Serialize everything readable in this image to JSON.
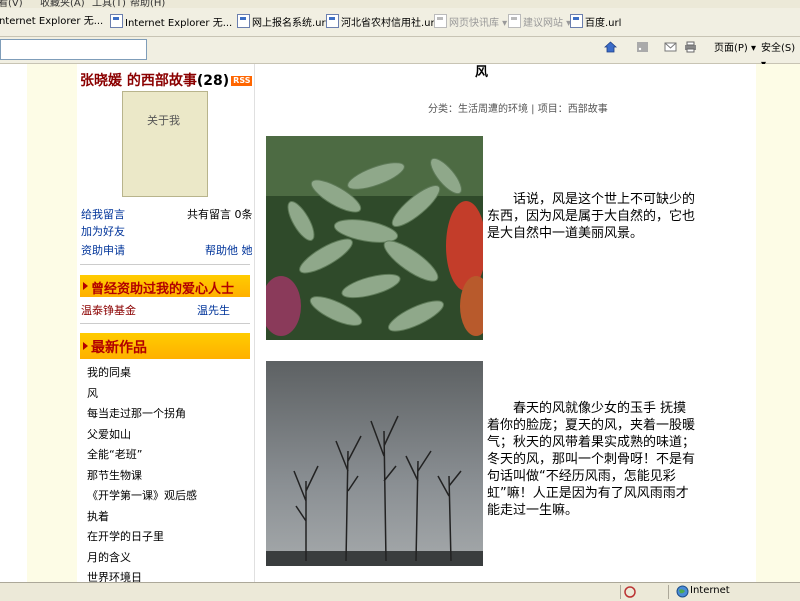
{
  "menu": {
    "items": [
      "看(V)",
      "收藏夹(A)",
      "工具(T)",
      "帮助(H)"
    ]
  },
  "favorites": [
    {
      "label": "Internet Explorer 无...",
      "gray": false
    },
    {
      "label": "Internet Explorer 无...",
      "gray": false
    },
    {
      "label": "网上报名系统.url",
      "gray": false
    },
    {
      "label": "河北省农村信用社.url",
      "gray": false
    },
    {
      "label": "网页快讯库 ▾",
      "gray": true
    },
    {
      "label": "建议网站 ▾",
      "gray": true
    },
    {
      "label": "百度.url",
      "gray": false
    }
  ],
  "toolbar": {
    "page_label": "页面(P) ▾",
    "safety_label": "安全(S) ▾"
  },
  "sidebar": {
    "blog_title": "张晓媛 的西部故事",
    "post_count": "(28)",
    "rss": "RSS",
    "avatar_text": "关于我",
    "leave_message": "给我留言",
    "message_count": "共有留言 0条",
    "add_friend": "加为好友",
    "apply_aid": "资助申请",
    "help_her": "帮助他 她",
    "donors_heading": "曾经资助过我的爱心人士",
    "donor1": "温泰铮基金",
    "donor2": "温先生",
    "latest_heading": "最新作品",
    "latest_works": [
      "我的同桌",
      "风",
      "每当走过那一个拐角",
      "父爱如山",
      "全能“老班”",
      "那节生物课",
      "《开学第一课》观后感",
      "执着",
      "在开学的日子里",
      "月的含义",
      "世界环境日"
    ]
  },
  "article": {
    "title": "风",
    "category": "分类：生活周遭的环境 | 项目：西部故事",
    "para1": "话说，风是这个世上不可缺少的东西，因为风是属于大自然的，它也是大自然中一道美丽风景。",
    "para2": "春天的风就像少女的玉手 抚摸着你的脸庞；夏天的风，夹着一股暖气；秋天的风带着果实成熟的味道；冬天的风，那叫一个刺骨呀！不是有句话叫做“不经历风雨，怎能见彩虹”嘛！人正是因为有了风风雨雨才能走过一生嘛。"
  },
  "status": {
    "zone": "Internet"
  }
}
